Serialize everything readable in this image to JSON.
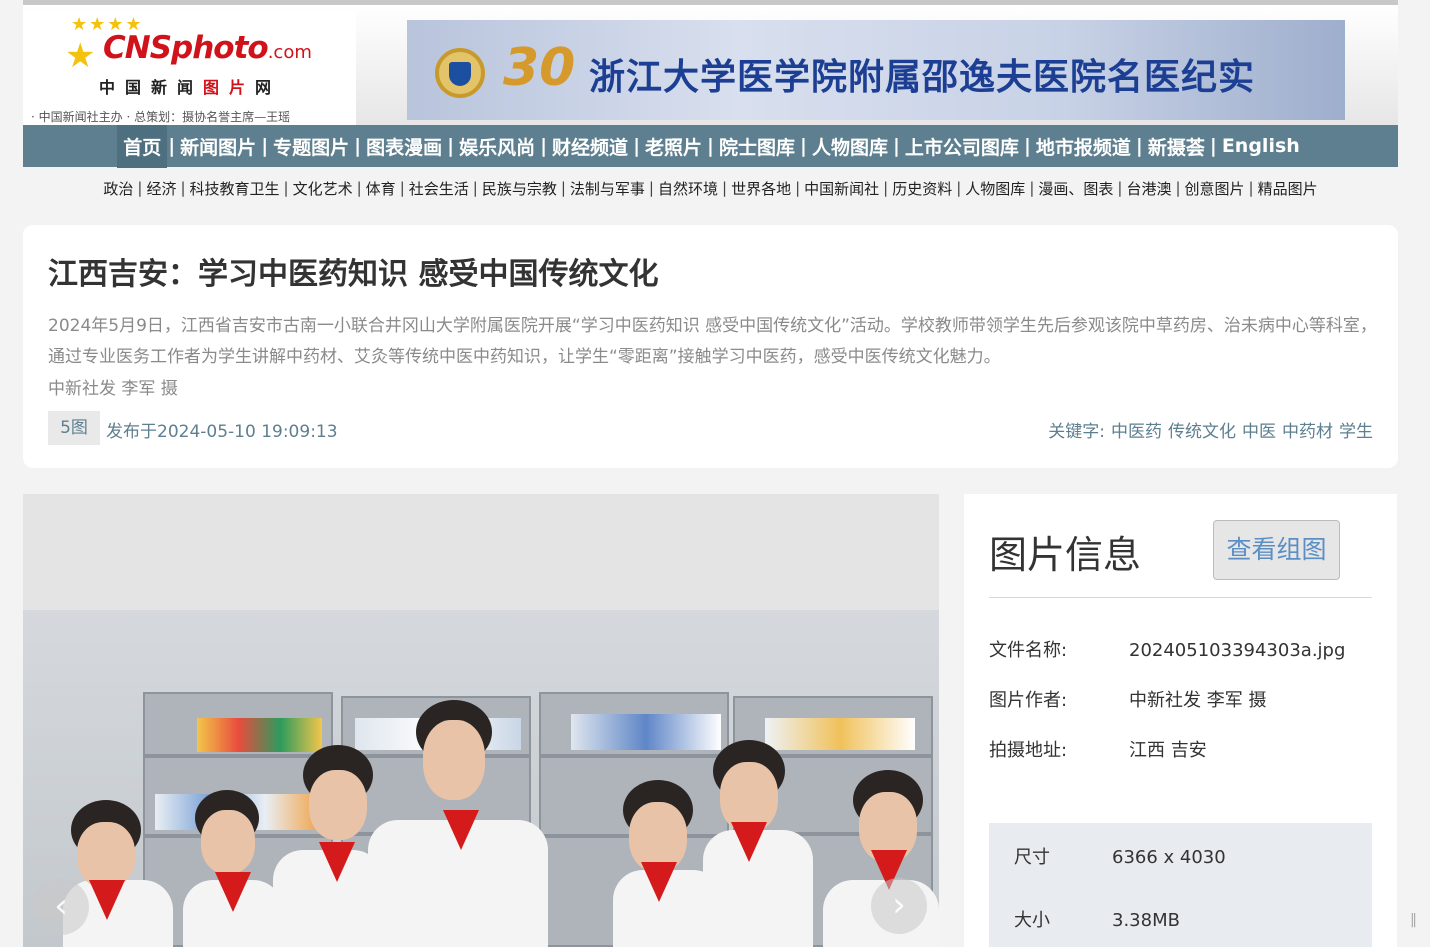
{
  "logo": {
    "name": "CNSphoto",
    "dotcom": ".com",
    "cn_part1": "中国新闻",
    "cn_part2": "图片",
    "cn_part3": "网",
    "sub": "· 中国新闻社主办  · 总策划：摄协名誉主席—王瑶"
  },
  "banner": {
    "anniversary": "30",
    "title": "浙江大学医学院附属邵逸夫医院名医纪实"
  },
  "main_nav": [
    {
      "label": "首页"
    },
    {
      "label": "新闻图片"
    },
    {
      "label": "专题图片"
    },
    {
      "label": "图表漫画"
    },
    {
      "label": "娱乐风尚"
    },
    {
      "label": "财经频道"
    },
    {
      "label": "老照片"
    },
    {
      "label": "院士图库"
    },
    {
      "label": "人物图库"
    },
    {
      "label": "上市公司图库"
    },
    {
      "label": "地市报频道"
    },
    {
      "label": "新摄荟"
    },
    {
      "label": "English"
    }
  ],
  "main_nav_sep": "|",
  "sub_nav": [
    {
      "label": "政治"
    },
    {
      "label": "经济"
    },
    {
      "label": "科技教育卫生"
    },
    {
      "label": "文化艺术"
    },
    {
      "label": "体育"
    },
    {
      "label": "社会生活"
    },
    {
      "label": "民族与宗教"
    },
    {
      "label": "法制与军事"
    },
    {
      "label": "自然环境"
    },
    {
      "label": "世界各地"
    },
    {
      "label": "中国新闻社"
    },
    {
      "label": "历史资料"
    },
    {
      "label": "人物图库"
    },
    {
      "label": "漫画、图表"
    },
    {
      "label": "台港澳"
    },
    {
      "label": "创意图片"
    },
    {
      "label": "精品图片"
    }
  ],
  "article": {
    "title": "江西吉安：学习中医药知识 感受中国传统文化",
    "description": "2024年5月9日，江西省吉安市古南一小联合井冈山大学附属医院开展“学习中医药知识 感受中国传统文化”活动。学校教师带领学生先后参观该院中草药房、治未病中心等科室，通过专业医务工作者为学生讲解中药材、艾灸等传统中医中药知识，让学生“零距离”接触学习中医药，感受中医传统文化魅力。",
    "credit": "中新社发 李军 摄",
    "photo_count": "5图",
    "published": "发布于2024-05-10 19:09:13",
    "keywords_label": "关键字:",
    "keywords": [
      {
        "label": "中医药"
      },
      {
        "label": "传统文化"
      },
      {
        "label": "中医"
      },
      {
        "label": "中药材"
      },
      {
        "label": "学生"
      }
    ]
  },
  "viewer": {
    "prev_icon": "‹",
    "next_icon": "›"
  },
  "info": {
    "title": "图片信息",
    "view_group_button": "查看组图",
    "file_name_label": "文件名称:",
    "file_name": "202405103394303a.jpg",
    "author_label": "图片作者:",
    "author": "中新社发 李军 摄",
    "location_label": "拍摄地址:",
    "location": "江西 吉安",
    "size_label": "尺寸",
    "size": "6366 x 4030",
    "filesize_label": "大小",
    "filesize": "3.38MB"
  },
  "colors": {
    "nav_bg": "#5d7f8f",
    "brand_red": "#d0121b",
    "link": "#5d7f8f",
    "button_text": "#5b8fc4"
  }
}
